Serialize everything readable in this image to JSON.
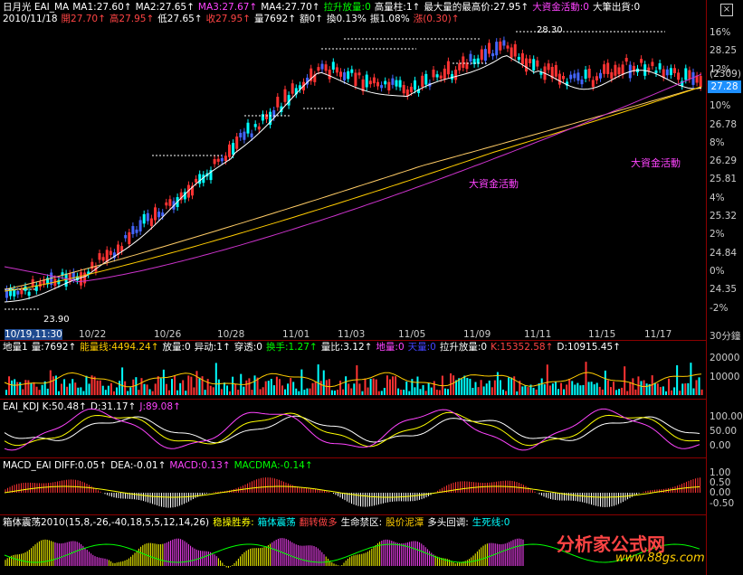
{
  "main": {
    "line1": [
      {
        "t": "日月光 EAI_MA",
        "c": "#ffffff"
      },
      {
        "t": "MA1:27.60↑",
        "c": "#ffffff"
      },
      {
        "t": "MA2:27.65↑",
        "c": "#ffffff"
      },
      {
        "t": "MA3:27.67↑",
        "c": "#ff44ff"
      },
      {
        "t": "MA4:27.70↑",
        "c": "#ffffff"
      },
      {
        "t": "拉升放量:0",
        "c": "#00ff00"
      },
      {
        "t": "高量柱:1↑",
        "c": "#ffffff"
      },
      {
        "t": "最大量的最高价:27.95↑",
        "c": "#ffffff"
      },
      {
        "t": "大資金活動:0",
        "c": "#ff44ff"
      },
      {
        "t": "大筆出貨:0",
        "c": "#ffffff"
      }
    ],
    "line2": [
      {
        "t": "2010/11/18",
        "c": "#ffffff"
      },
      {
        "t": "開27.70↑",
        "c": "#ff4444"
      },
      {
        "t": "高27.95↑",
        "c": "#ff4444"
      },
      {
        "t": "低27.65↑",
        "c": "#ffffff"
      },
      {
        "t": "收27.95↑",
        "c": "#ff4444"
      },
      {
        "t": "量7692↑",
        "c": "#ffffff"
      },
      {
        "t": "額0↑",
        "c": "#ffffff"
      },
      {
        "t": "換0.13%",
        "c": "#ffffff"
      },
      {
        "t": "振1.08%",
        "c": "#ffffff"
      },
      {
        "t": "漲(0.30)↑",
        "c": "#ff4444"
      }
    ],
    "right_axis": [
      "16%",
      "28.25",
      "12%",
      "27.27",
      "10%",
      "26.78",
      "8%",
      "26.29",
      "25.81",
      "4%",
      "25.32",
      "2%",
      "24.84",
      "0%",
      "24.35",
      "-2%"
    ],
    "current_price": "27.28",
    "current_tag": "(2309)",
    "dates": [
      "10/19,11:30",
      "10/22",
      "10/26",
      "10/28",
      "11/01",
      "11/03",
      "11/05",
      "11/09",
      "11/11",
      "11/15",
      "11/17"
    ],
    "period": "30分鐘",
    "annotations": [
      "大資金活動",
      "大資金活動"
    ],
    "high_label": "28.30",
    "low_label": "23.90"
  },
  "vol": {
    "header": [
      {
        "t": "地量1",
        "c": "#ffffff"
      },
      {
        "t": "量:7692↑",
        "c": "#ffffff"
      },
      {
        "t": "能量线:4494.24↑",
        "c": "#ffcc00"
      },
      {
        "t": "放量:0",
        "c": "#ffffff"
      },
      {
        "t": "异动:1↑",
        "c": "#ffffff"
      },
      {
        "t": "穿透:0",
        "c": "#ffffff"
      },
      {
        "t": "换手:1.27↑",
        "c": "#00ff00"
      },
      {
        "t": "量比:3.12↑",
        "c": "#ffffff"
      },
      {
        "t": "地量:0",
        "c": "#ff44ff"
      },
      {
        "t": "天量:0",
        "c": "#4444ff"
      },
      {
        "t": "拉升放量:0",
        "c": "#ffffff"
      },
      {
        "t": "K:15352.58↑",
        "c": "#ff4444"
      },
      {
        "t": "D:10915.45↑",
        "c": "#ffffff"
      }
    ],
    "axis": [
      "20000",
      "10000"
    ]
  },
  "kdj": {
    "header": [
      {
        "t": "EAI_KDJ K:50.48↑",
        "c": "#ffffff"
      },
      {
        "t": "D:31.17↑",
        "c": "#ffffff"
      },
      {
        "t": "J:89.08↑",
        "c": "#ff44ff"
      }
    ],
    "axis": [
      "100.00",
      "50.00",
      "0.00"
    ]
  },
  "macd": {
    "header": [
      {
        "t": "MACD_EAI DIFF:0.05↑",
        "c": "#ffffff"
      },
      {
        "t": "DEA:-0.01↑",
        "c": "#ffffff"
      },
      {
        "t": "MACD:0.13↑",
        "c": "#ff44ff"
      },
      {
        "t": "MACDMA:-0.14↑",
        "c": "#00ff00"
      }
    ],
    "axis": [
      "1.00",
      "0.50",
      "0.00",
      "-0.50"
    ]
  },
  "box": {
    "header": [
      {
        "t": "箱体震荡2010(15,8,-26,-40,18,5,5,12,14,26)",
        "c": "#ffffff"
      },
      {
        "t": "稳操胜券:",
        "c": "#ffff00"
      },
      {
        "t": "箱体震荡",
        "c": "#00ffff"
      },
      {
        "t": "翻转做多",
        "c": "#ff4444"
      },
      {
        "t": "生命禁区:",
        "c": "#ffffff"
      },
      {
        "t": "股价泥潭",
        "c": "#ffcc00"
      },
      {
        "t": "多头回调:",
        "c": "#ffffff"
      },
      {
        "t": "生死线:0",
        "c": "#00ffff"
      }
    ]
  },
  "watermark": {
    "title": "分析家公式网",
    "url": "www.88gs.com"
  },
  "close_label": "×"
}
